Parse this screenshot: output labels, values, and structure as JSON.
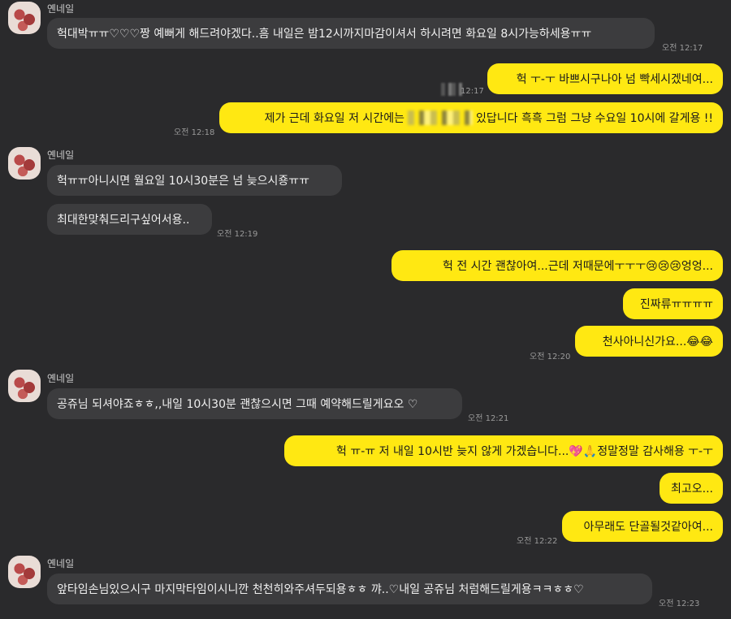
{
  "chat": {
    "sender_name": "옌네일",
    "messages": [
      {
        "id": "m1",
        "side": "in",
        "text": "헉대박ㅠㅠ♡♡♡짱 예뻐게 해드려야겠다..흠 내일은 밤12시까지마감이셔서 하시려면 화요일 8시가능하세용ㅠㅠ",
        "time": "오전 12:17"
      },
      {
        "id": "m2",
        "side": "out",
        "text": "헉 ㅜ-ㅜ 바쁘시구나아 넘 빡세시겠네여...",
        "time": "12:17"
      },
      {
        "id": "m3",
        "side": "out",
        "text_before": "제가 근데 화요일 저 시간에는",
        "text_after": "있답니다 흑흑 그럼 그냥 수요일 10시에 갈게용 !!",
        "time": "오전 12:18"
      },
      {
        "id": "m4",
        "side": "in",
        "text": "헉ㅠㅠ아니시면 월요일 10시30분은 넘 늦으시죵ㅠㅠ",
        "time": ""
      },
      {
        "id": "m5",
        "side": "in",
        "text": "최대한맞춰드리구싶어서용..",
        "time": "오전 12:19"
      },
      {
        "id": "m6",
        "side": "out",
        "text": "헉 전 시간 괜찮아여...근데 저때문에ㅜㅜㅜ😢😢😢엉엉...",
        "time": ""
      },
      {
        "id": "m7",
        "side": "out",
        "text": "진짜류ㅠㅠㅠㅠ",
        "time": ""
      },
      {
        "id": "m8",
        "side": "out",
        "text": "천사아니신가요...😂😂",
        "time": "오전 12:20"
      },
      {
        "id": "m9",
        "side": "in",
        "text": "공쥬님 되셔야죠ㅎㅎ,,내일 10시30분 괜찮으시면 그때 예약해드릴게요오 ♡",
        "time": "오전 12:21"
      },
      {
        "id": "m10",
        "side": "out",
        "text": "헉 ㅠ-ㅠ 저 내일 10시반 늦지 않게 가겠습니다...💖🙏정말정말 감사해용 ㅜ-ㅜ",
        "time": ""
      },
      {
        "id": "m11",
        "side": "out",
        "text": "최고오...",
        "time": ""
      },
      {
        "id": "m12",
        "side": "out",
        "text": "아무래도 단골될것같아여...",
        "time": "오전 12:22"
      },
      {
        "id": "m13",
        "side": "in",
        "text": "앞타임손님있으시구 마지막타임이시니깐  천천히와주셔두되용ㅎㅎ 꺄..♡내일 공쥬님 처럼해드릴게용ㅋㅋㅎㅎ♡",
        "time": "오전 12:23"
      }
    ]
  }
}
